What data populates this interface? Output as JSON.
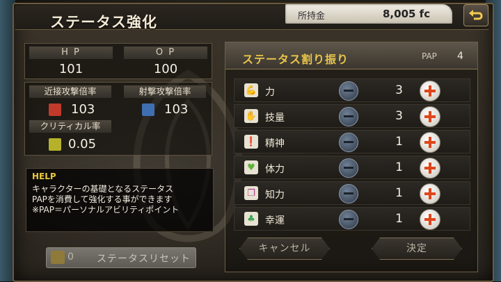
{
  "header": {
    "title": "ステータス強化",
    "money_label": "所持金",
    "money_value": "8,005 fc"
  },
  "stats": {
    "hp_label": "H P",
    "hp_value": "101",
    "op_label": "O P",
    "op_value": "100",
    "melee_label": "近接攻撃倍率",
    "melee_value": "103",
    "ranged_label": "射撃攻撃倍率",
    "ranged_value": "103",
    "crit_label": "クリティカル率",
    "crit_value": "0.05"
  },
  "help": {
    "title": "HELP",
    "lines": [
      "キャラクターの基礎となるステータス",
      "PAPを消費して強化する事ができます",
      "※PAP＝パーソナルアビリティポイント"
    ]
  },
  "reset": {
    "count": "0",
    "label": "ステータスリセット"
  },
  "allocation": {
    "title": "ステータス割り振り",
    "pap_label": "PAP",
    "pap_value": "4",
    "rows": [
      {
        "label": "力",
        "value": "3",
        "icon": "arm-icon"
      },
      {
        "label": "技量",
        "value": "3",
        "icon": "hand-icon"
      },
      {
        "label": "精神",
        "value": "1",
        "icon": "spirit-icon"
      },
      {
        "label": "体力",
        "value": "1",
        "icon": "heart-icon"
      },
      {
        "label": "知力",
        "value": "1",
        "icon": "book-icon"
      },
      {
        "label": "幸運",
        "value": "1",
        "icon": "clover-icon"
      }
    ]
  },
  "buttons": {
    "cancel": "キャンセル",
    "confirm": "決定"
  }
}
